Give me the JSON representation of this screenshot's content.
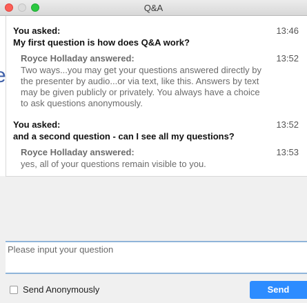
{
  "window": {
    "title": "Q&A"
  },
  "thread": [
    {
      "asked_label": "You asked:",
      "time": "13:46",
      "question": "My first question is how does Q&A work?",
      "answer": {
        "answerer": "Royce Holladay answered:",
        "time": "13:52",
        "lines": [
          "Two ways...you may get your questions answered directly by",
          "the presenter by audio...or via text, like this. Answers by text",
          "may be given publicly or privately. You always have a choice",
          "to ask questions anonymously."
        ]
      }
    },
    {
      "asked_label": "You asked:",
      "time": "13:52",
      "question": "and a second question - can I see all my questions?",
      "answer": {
        "answerer": "Royce Holladay answered:",
        "time": "13:53",
        "lines": [
          "yes, all of your questions remain visible to you."
        ]
      }
    }
  ],
  "input": {
    "placeholder": "Please input your question"
  },
  "anonymous": {
    "label": "Send Anonymously",
    "checked": false
  },
  "send": {
    "label": "Send",
    "color": "#2d8cff"
  }
}
